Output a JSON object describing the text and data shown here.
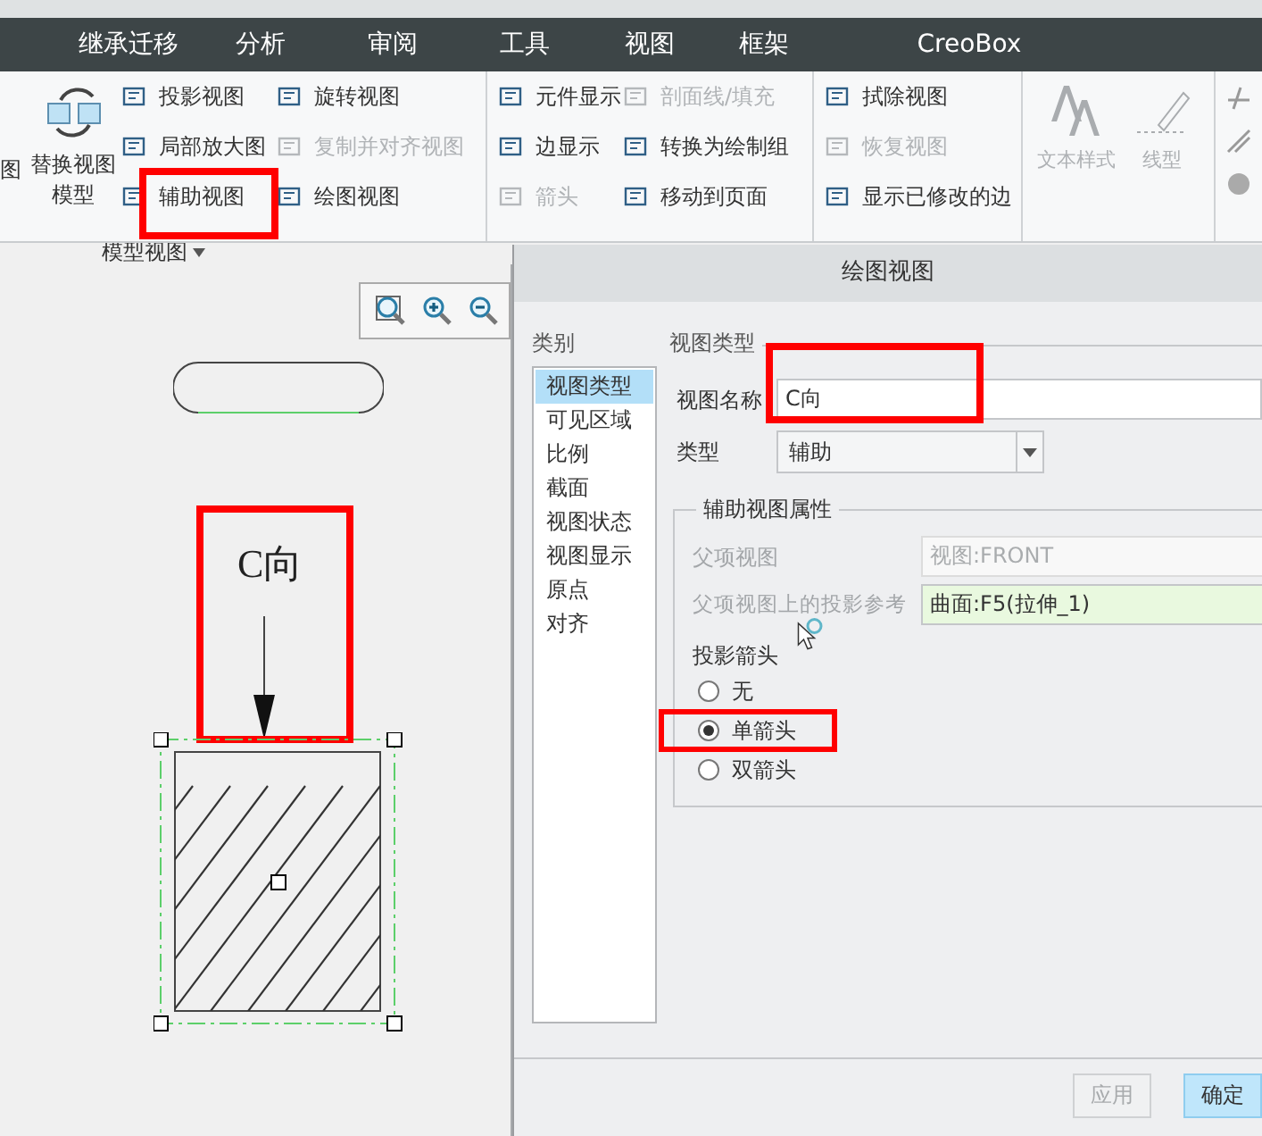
{
  "menu_tabs": [
    {
      "label": "继承迁移"
    },
    {
      "label": "分析"
    },
    {
      "label": "审阅"
    },
    {
      "label": "工具"
    },
    {
      "label": "视图"
    },
    {
      "label": "框架"
    },
    {
      "label": "CreoBox"
    }
  ],
  "ribbon": {
    "cut_label": "图",
    "big_button": {
      "line_1": "替换视图",
      "line_2": "模型"
    },
    "group_label": "模型视图",
    "columns": [
      [
        {
          "label": "投影视图",
          "disabled": false
        },
        {
          "label": "局部放大图",
          "disabled": false
        },
        {
          "label": "辅助视图",
          "disabled": false
        }
      ],
      [
        {
          "label": "旋转视图",
          "disabled": false
        },
        {
          "label": "复制并对齐视图",
          "disabled": true
        },
        {
          "label": "绘图视图",
          "disabled": false
        }
      ],
      [
        {
          "label": "元件显示",
          "disabled": false
        },
        {
          "label": "边显示",
          "disabled": false
        },
        {
          "label": "箭头",
          "disabled": true
        }
      ],
      [
        {
          "label": "剖面线/填充",
          "disabled": true
        },
        {
          "label": "转换为绘制组",
          "disabled": false
        },
        {
          "label": "移动到页面",
          "disabled": false
        }
      ],
      [
        {
          "label": "拭除视图",
          "disabled": false
        },
        {
          "label": "恢复视图",
          "disabled": true
        },
        {
          "label": "显示已修改的边",
          "disabled": false
        }
      ]
    ],
    "format_buttons": [
      {
        "label": "文本样式",
        "disabled": true
      },
      {
        "label": "线型",
        "disabled": true
      }
    ]
  },
  "canvas": {
    "view_label": "C向"
  },
  "dialog": {
    "title": "绘图视图",
    "category_label": "类别",
    "categories": [
      {
        "label": "视图类型",
        "selected": true
      },
      {
        "label": "可见区域",
        "selected": false
      },
      {
        "label": "比例",
        "selected": false
      },
      {
        "label": "截面",
        "selected": false
      },
      {
        "label": "视图状态",
        "selected": false
      },
      {
        "label": "视图显示",
        "selected": false
      },
      {
        "label": "原点",
        "selected": false
      },
      {
        "label": "对齐",
        "selected": false
      }
    ],
    "section_title": "视图类型",
    "view_name": {
      "label": "视图名称",
      "value": "C向"
    },
    "type": {
      "label": "类型",
      "value": "辅助"
    },
    "properties": {
      "title": "辅助视图属性",
      "parent_view": {
        "label": "父项视图",
        "value": "视图:FRONT",
        "disabled": true
      },
      "projection_ref": {
        "label": "父项视图上的投影参考",
        "value": "曲面:F5(拉伸_1)"
      },
      "arrow_label": "投影箭头",
      "arrow_options": [
        {
          "label": "无",
          "selected": false
        },
        {
          "label": "单箭头",
          "selected": true
        },
        {
          "label": "双箭头",
          "selected": false
        }
      ]
    },
    "buttons": [
      {
        "label": "应用",
        "disabled": true,
        "primary": false
      },
      {
        "label": "确定",
        "disabled": false,
        "primary": true
      }
    ]
  }
}
